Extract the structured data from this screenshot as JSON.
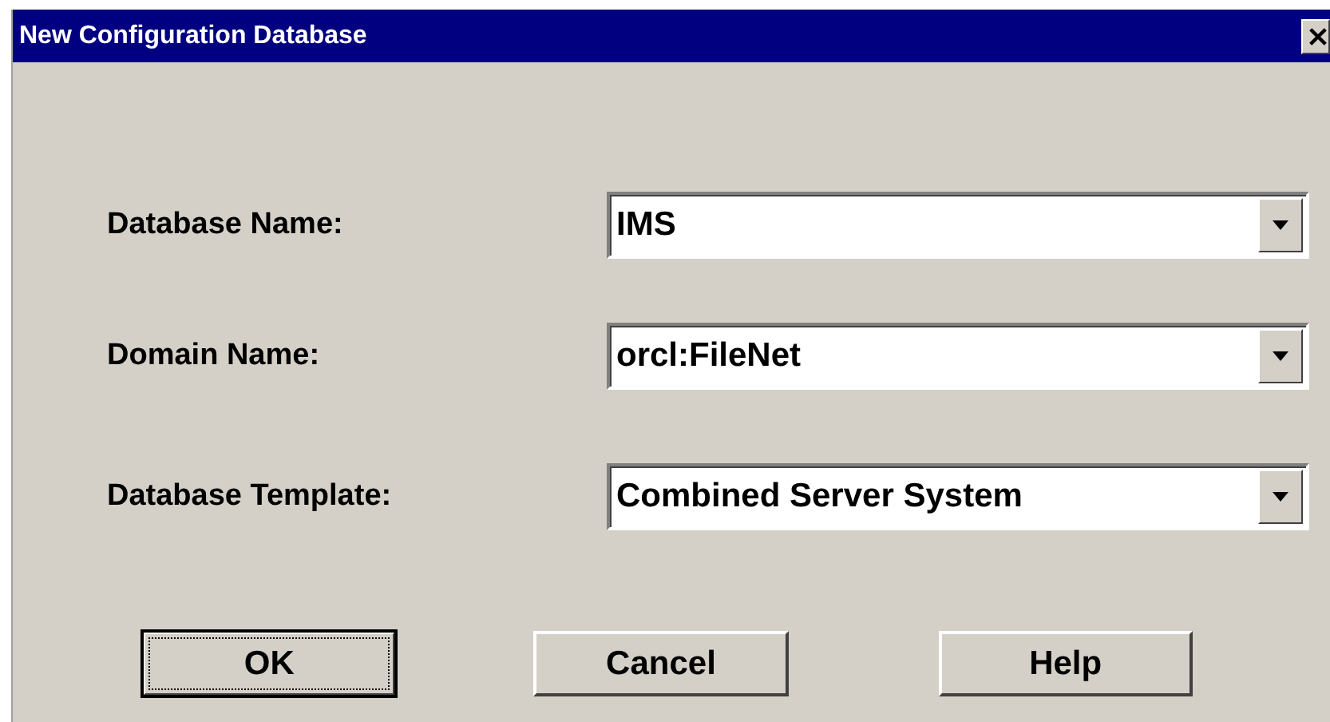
{
  "window": {
    "title": "New Configuration Database"
  },
  "fields": [
    {
      "label": "Database Name:",
      "value": "IMS"
    },
    {
      "label": "Domain Name:",
      "value": "orcl:FileNet"
    },
    {
      "label": "Database Template:",
      "value": "Combined Server System"
    }
  ],
  "buttons": [
    {
      "label": "OK",
      "default": true
    },
    {
      "label": "Cancel",
      "default": false
    },
    {
      "label": "Help",
      "default": false
    }
  ]
}
